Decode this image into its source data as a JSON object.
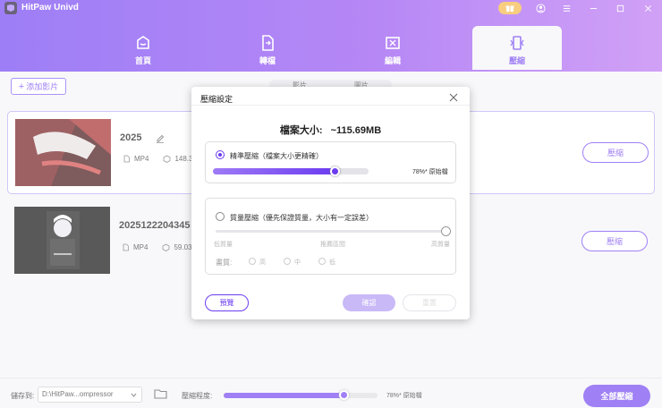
{
  "app": {
    "title": "HitPaw Univd"
  },
  "colors": {
    "accent": "#6c3cf0",
    "header_start": "#6a3af2",
    "header_end": "#b86ff2"
  },
  "window_icons": [
    "gift-icon",
    "user-icon",
    "menu-icon",
    "minimize-icon",
    "maximize-icon",
    "close-icon"
  ],
  "nav": {
    "tabs": [
      {
        "label": "首頁",
        "icon": "home-icon"
      },
      {
        "label": "轉檔",
        "icon": "convert-icon"
      },
      {
        "label": "編輯",
        "icon": "edit-icon"
      },
      {
        "label": "壓縮",
        "icon": "compress-icon",
        "active": true
      }
    ]
  },
  "toolbar": {
    "add_label": "添加影片"
  },
  "segment": {
    "video_label": "影片",
    "image_label": "圖片"
  },
  "files": [
    {
      "name": "2025",
      "format": "MP4",
      "size": "148.32"
    },
    {
      "name": "2025122204345",
      "format": "MP4",
      "size": "59.03M"
    }
  ],
  "file_action": "壓縮",
  "bottom": {
    "save_label": "儲存到:",
    "path": "D:\\HitPaw...ompressor",
    "level_label": "壓縮程度:",
    "level_value": 0.78,
    "level_text": "78%* 原始檔",
    "compress_all": "全部壓縮"
  },
  "dialog": {
    "title": "壓縮設定",
    "size_label": "檔案大小:",
    "size_value": "~115.69MB",
    "option1": {
      "label": "精準壓縮（檔案大小更精確）",
      "value": 0.78,
      "value_text": "78%* 原始檔",
      "selected": true
    },
    "option2": {
      "label": "質量壓縮（優先保證質量，大小有一定誤差）",
      "value": 1.0,
      "scale": [
        "低質量",
        "推薦區間",
        "高質量"
      ],
      "quality_label": "畫質:",
      "quality_options": [
        "高",
        "中",
        "低"
      ]
    },
    "preview": "預覽",
    "confirm": "確認",
    "reset": "重置"
  }
}
